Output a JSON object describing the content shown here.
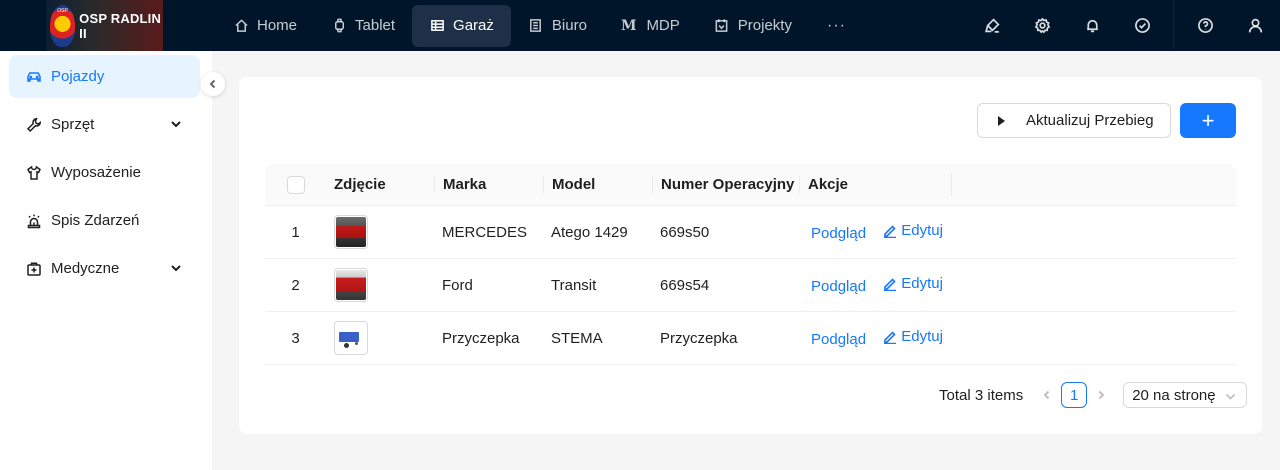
{
  "app": {
    "logo_text": "OSP RADLIN II",
    "logo_badge_text": "OSP"
  },
  "nav": {
    "items": [
      {
        "label": "Home",
        "icon": "home-icon"
      },
      {
        "label": "Tablet",
        "icon": "watch-icon"
      },
      {
        "label": "Garaż",
        "icon": "table-icon",
        "active": true
      },
      {
        "label": "Biuro",
        "icon": "document-icon"
      },
      {
        "label": "MDP",
        "icon": "m-letter-icon"
      },
      {
        "label": "Projekty",
        "icon": "project-icon"
      }
    ],
    "more": "···"
  },
  "toolbar_icons": [
    "highlighter-icon",
    "settings-icon",
    "bell-icon",
    "check-circle-icon",
    "help-icon",
    "user-icon"
  ],
  "sidebar": {
    "items": [
      {
        "label": "Pojazdy",
        "icon": "car-icon",
        "active": true
      },
      {
        "label": "Sprzęt",
        "icon": "wrench-icon",
        "expandable": true
      },
      {
        "label": "Wyposażenie",
        "icon": "shirt-icon"
      },
      {
        "label": "Spis Zdarzeń",
        "icon": "alarm-icon"
      },
      {
        "label": "Medyczne",
        "icon": "medical-icon",
        "expandable": true
      }
    ]
  },
  "actions": {
    "update_label": "Aktualizuj Przebieg",
    "add_label": "+"
  },
  "table": {
    "headers": {
      "photo": "Zdjęcie",
      "brand": "Marka",
      "model": "Model",
      "op_number": "Numer Operacyjny",
      "actions": "Akcje"
    },
    "rows": [
      {
        "num": "1",
        "brand": "MERCEDES",
        "model": "Atego 1429",
        "op_number": "669s50",
        "view": "Podgląd",
        "edit": "Edytuj"
      },
      {
        "num": "2",
        "brand": "Ford",
        "model": "Transit",
        "op_number": "669s54",
        "view": "Podgląd",
        "edit": "Edytuj"
      },
      {
        "num": "3",
        "brand": "Przyczepka",
        "model": "STEMA",
        "op_number": "Przyczepka",
        "view": "Podgląd",
        "edit": "Edytuj"
      }
    ]
  },
  "pagination": {
    "total": "Total 3 items",
    "current_page": "1",
    "page_size": "20 na stronę"
  },
  "colors": {
    "header_bg": "#001529",
    "accent": "#1677ff",
    "active_bg": "#e6f4ff"
  }
}
